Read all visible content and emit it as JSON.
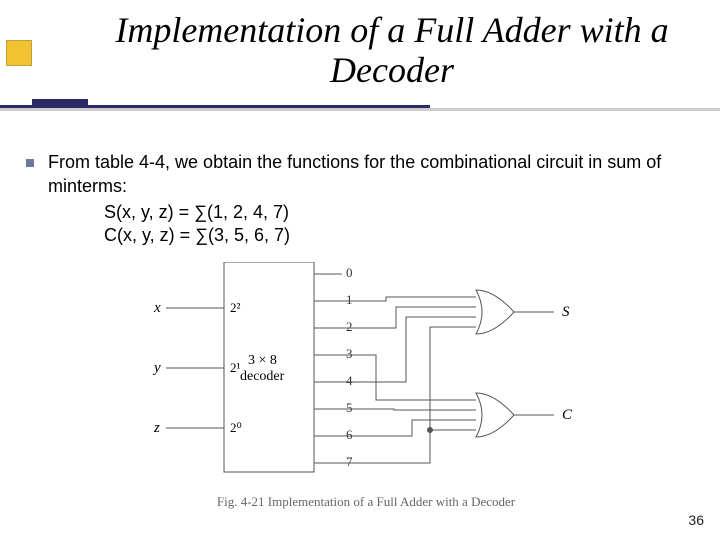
{
  "title": "Implementation of a Full Adder with a Decoder",
  "bullet": "From table 4-4, we obtain the functions for the combinational circuit in sum of minterms:",
  "eq_s": "S(x, y, z) = ∑(1, 2, 4, 7)",
  "eq_c": "C(x, y, z) = ∑(3, 5, 6, 7)",
  "fig": {
    "inputs": {
      "x": "x",
      "y": "y",
      "z": "z"
    },
    "weights": {
      "x": "2²",
      "y": "2¹",
      "z": "2⁰"
    },
    "block_label_top": "3 × 8",
    "block_label_bottom": "decoder",
    "outputs": [
      "0",
      "1",
      "2",
      "3",
      "4",
      "5",
      "6",
      "7"
    ],
    "gate_out_s": "S",
    "gate_out_c": "C",
    "caption": "Fig. 4-21   Implementation of a Full Adder with a Decoder"
  },
  "pagenum": "36"
}
